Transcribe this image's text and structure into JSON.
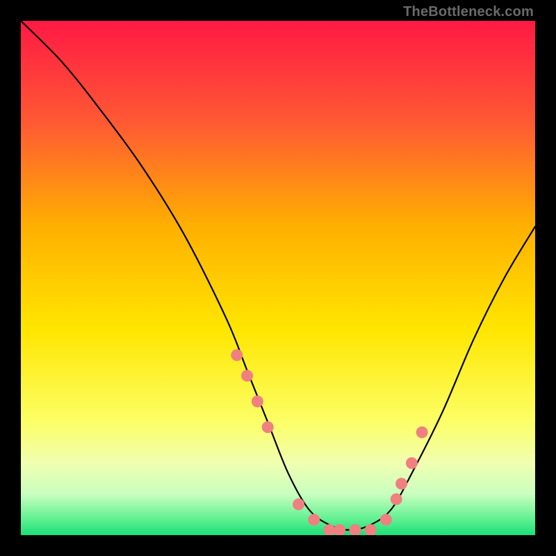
{
  "watermark": "TheBottleneck.com",
  "chart_data": {
    "type": "line",
    "title": "",
    "xlabel": "",
    "ylabel": "",
    "xlim": [
      0,
      100
    ],
    "ylim": [
      0,
      100
    ],
    "grid": false,
    "legend": false,
    "series": [
      {
        "name": "bottleneck-curve",
        "x": [
          0,
          8,
          16,
          24,
          32,
          40,
          44,
          48,
          52,
          56,
          60,
          64,
          68,
          72,
          76,
          82,
          88,
          94,
          100
        ],
        "y": [
          100,
          92,
          82,
          71,
          58,
          42,
          32,
          22,
          12,
          5,
          2,
          1,
          2,
          5,
          12,
          24,
          38,
          50,
          60
        ]
      }
    ],
    "markers": {
      "name": "highlighted-points",
      "color": "#f08080",
      "x": [
        42,
        44,
        46,
        48,
        54,
        57,
        60,
        62,
        65,
        68,
        71,
        73,
        74,
        76,
        78
      ],
      "y": [
        35,
        31,
        26,
        21,
        6,
        3,
        1,
        1,
        1,
        1,
        3,
        7,
        10,
        14,
        20
      ]
    },
    "gradient_stops": [
      {
        "offset": 0.0,
        "color": "#ff1944"
      },
      {
        "offset": 0.2,
        "color": "#ff5a33"
      },
      {
        "offset": 0.4,
        "color": "#ffb000"
      },
      {
        "offset": 0.6,
        "color": "#ffe600"
      },
      {
        "offset": 0.78,
        "color": "#fcff66"
      },
      {
        "offset": 0.86,
        "color": "#f0ffb0"
      },
      {
        "offset": 0.92,
        "color": "#c9ffc0"
      },
      {
        "offset": 0.97,
        "color": "#5ef090"
      },
      {
        "offset": 1.0,
        "color": "#19e07a"
      }
    ]
  }
}
